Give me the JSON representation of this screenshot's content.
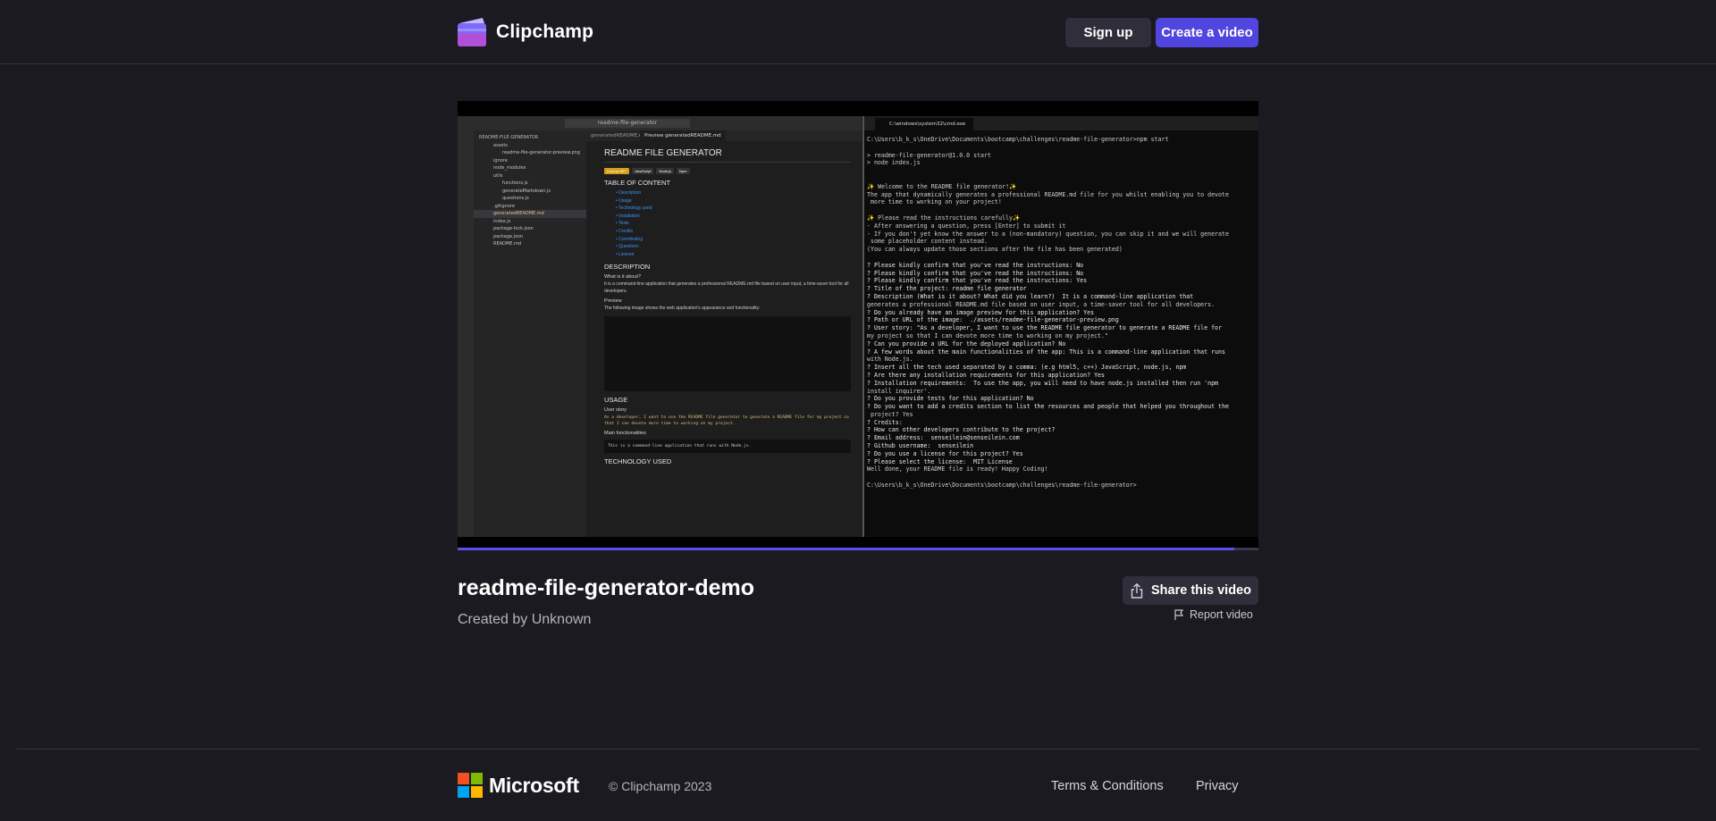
{
  "header": {
    "brand": "Clipchamp",
    "signup_label": "Sign up",
    "create_label": "Create a video",
    "accent": "#5145e0"
  },
  "video": {
    "title": "readme-file-generator-demo",
    "created_by": "Created by Unknown",
    "share_label": "Share this video",
    "report_label": "Report video",
    "progress": 0.97,
    "screen": {
      "vscode_search": "readme-file-generator",
      "explorer_header": "README-FILE-GENERATOR",
      "explorer_items": [
        "assets",
        "readme-file-generator-preview.png",
        "ignore",
        "node_modules",
        "utils",
        "functions.js",
        "generateMarkdown.js",
        "questions.js",
        ".gitignore",
        "generatedREADME.md",
        "index.js",
        "package-lock.json",
        "package.json",
        "README.md"
      ],
      "tab1": "generatedREADME.md",
      "tab2": "Preview generatedREADME.md",
      "md_title": "README FILE GENERATOR",
      "badges": [
        "License MIT",
        "JavaScript",
        "Node.js",
        "Npm"
      ],
      "toc_heading": "TABLE OF CONTENT",
      "toc": [
        "Description",
        "Usage",
        "Technology used",
        "Installation",
        "Tests",
        "Credits",
        "Contributing",
        "Questions",
        "License"
      ],
      "desc_heading": "DESCRIPTION",
      "what_heading": "What is it about?",
      "what_text": "It is a command-line application that generates a professional README.md file based on user input, a time-saver tool for all developers.",
      "preview_heading": "Preview",
      "preview_text": "The following image shows the web application's appearance and functionality:",
      "usage_heading": "USAGE",
      "story_heading": "User story",
      "story_text": "As a developer, I want to use the README file generator to generate a README file for my project so that I can devote more time to working on my project.",
      "func_heading": "Main functionalities",
      "func_text": "This is a command-line application that runs with Node.js.",
      "tech_heading": "TECHNOLOGY USED",
      "term_tab": "C:\\windows\\system32\\cmd.exe",
      "term_lines": [
        "C:\\Users\\b_k_s\\OneDrive\\Documents\\bootcamp\\challenges\\readme-file-generator>npm start",
        "",
        "> readme-file-generator@1.0.0 start",
        "> node index.js",
        "",
        "",
        "✨ Welcome to the README file generator!✨",
        "The app that dynamically generates a professional README.md file for you whilst enabling you to devote",
        " more time to working on your project!",
        "",
        "✨ Please read the instructions carefully✨",
        "- After answering a question, press [Enter] to submit it",
        "- If you don't yet know the answer to a (non-mandatory) question, you can skip it and we will generate",
        " some placeholder content instead.",
        "(You can always update those sections after the file has been generated)",
        "",
        "? Please kindly confirm that you've read the instructions: No",
        "? Please kindly confirm that you've read the instructions: No",
        "? Please kindly confirm that you've read the instructions: Yes",
        "? Title of the project: readme file generator",
        "? Description (What is it about? What did you learn?)  It is a command-line application that",
        "generates a professional README.md file based on user input, a time-saver tool for all developers.",
        "? Do you already have an image preview for this application? Yes",
        "? Path or URL of the image:  ./assets/readme-file-generator-preview.png",
        "? User story: \"As a developer, I want to use the README file generator to generate a README file for",
        "my project so that I can devote more time to working on my project.\"",
        "? Can you provide a URL for the deployed application? No",
        "? A few words about the main functionalities of the app: This is a command-line application that runs",
        "with Node.js.",
        "? Insert all the tech used separated by a comma: (e.g html5, c++) JavaScript, node.js, npm",
        "? Are there any installation requirements for this application? Yes",
        "? Installation requirements:  To use the app, you will need to have node.js installed then run 'npm",
        "install inquirer'.",
        "? Do you provide tests for this application? No",
        "? Do you want to add a credits section to list the resources and people that helped you throughout the",
        " project? Yes",
        "? Credits:",
        "? How can other developers contribute to the project?",
        "? Email address:  senseilein@senseilein.com",
        "? Github username:  senseilein",
        "? Do you use a license for this project? Yes",
        "? Please select the license:  MIT License",
        "Well done, your README file is ready! Happy Coding!",
        "",
        "C:\\Users\\b_k_s\\OneDrive\\Documents\\bootcamp\\challenges\\readme-file-generator>"
      ]
    }
  },
  "footer": {
    "brand": "Microsoft",
    "copyright": "© Clipchamp 2023",
    "terms": "Terms & Conditions",
    "privacy": "Privacy"
  }
}
